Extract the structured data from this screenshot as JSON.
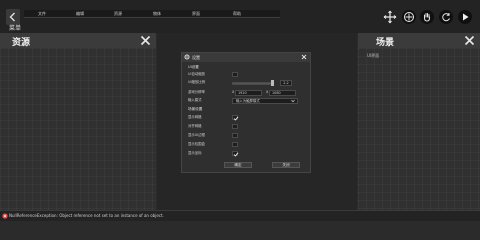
{
  "menu": {
    "items": [
      "文件",
      "编辑",
      "资源",
      "物体",
      "界面",
      "帮助"
    ],
    "label": "菜单"
  },
  "left_panel": {
    "title": "资源"
  },
  "right_panel": {
    "title": "场景",
    "subtitle": "UI界面"
  },
  "settings": {
    "title": "设置",
    "rows": {
      "ui_settings": "UI设置",
      "ui_auto_scale": "UI自动缩放",
      "ui_scale_ratio": "UI缩放比例",
      "ui_scale_value": "2.2",
      "resolution": "游戏分辨率",
      "res_width": "1920",
      "res_height": "1080",
      "x_label": "X",
      "mode": "输入模式",
      "mode_value": "输入为触屏模式",
      "scene_settings": "场景设置",
      "show_grid": "显示网格",
      "object_snap": "对齐网格",
      "show_ui_border": "显示UI边框",
      "show_bounds": "显示包围盒",
      "show_coords": "显示坐标"
    },
    "ok": "确定",
    "close": "关闭"
  },
  "status": {
    "error": "NullReferenceException: Object reference not set to an instance of an object."
  },
  "colors": {
    "background": "#2b2b2b",
    "panel": "#303030",
    "panel_header": "#3b3b3b",
    "dialog": "#2f2f2f",
    "error": "#d23b3b"
  },
  "icons": {
    "back": "chevron-left-icon",
    "move": "move-icon",
    "pan": "hand-icon",
    "rotate": "rotate-icon",
    "play": "play-icon",
    "close": "close-icon"
  }
}
